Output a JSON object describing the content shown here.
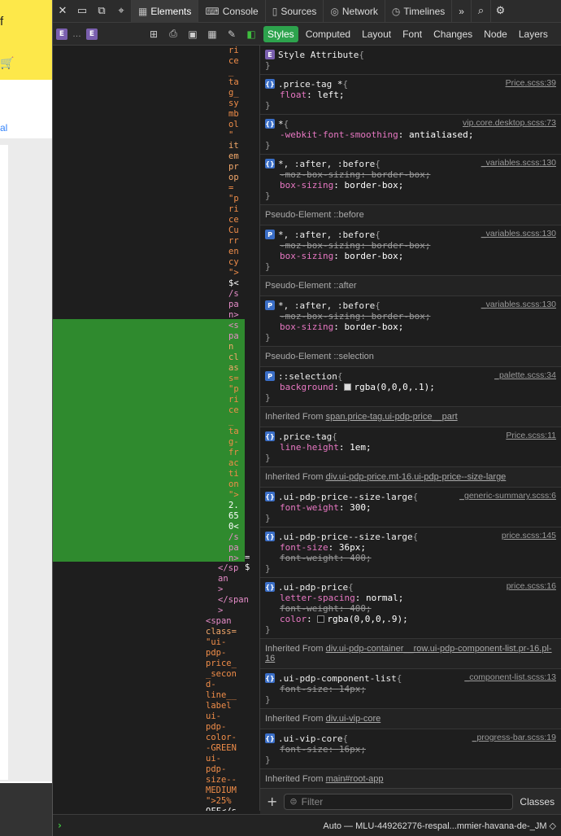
{
  "page": {
    "yellow_text": "f",
    "cart_icon": "cart-icon",
    "link_text": "al"
  },
  "toolbar": {
    "tabs": [
      {
        "label": "Elements",
        "icon": "elements-icon"
      },
      {
        "label": "Console",
        "icon": "console-icon"
      },
      {
        "label": "Sources",
        "icon": "sources-icon"
      },
      {
        "label": "Network",
        "icon": "network-icon"
      },
      {
        "label": "Timelines",
        "icon": "timelines-icon"
      }
    ],
    "more": "»"
  },
  "breadcrumb": {
    "badge1": "E",
    "ellipsis": "…",
    "badge2": "E"
  },
  "sidebar_tabs": [
    "Styles",
    "Computed",
    "Layout",
    "Font",
    "Changes",
    "Node",
    "Layers"
  ],
  "dom": {
    "col1": [
      "ri",
      "ce",
      "_",
      "ta",
      "g_",
      "sy",
      "mb",
      "ol",
      "\"",
      "it",
      "em",
      "pr",
      "op",
      "=",
      "\"p",
      "ri",
      "ce",
      "Cu",
      "rr",
      "en",
      "cy",
      "\">",
      "$<",
      "/s",
      "pa",
      "n>",
      "<s",
      "pa",
      "n",
      "cl",
      "as",
      "s=",
      "\"p",
      "ri",
      "ce",
      "_",
      "ta",
      "g-",
      "fr",
      "ac",
      "ti",
      "on",
      "\">",
      "2.",
      "65",
      "0<",
      "/s",
      "pa",
      "n>"
    ],
    "equals": "= $",
    "col2": [
      "</sp",
      "an",
      ">",
      "</span",
      ">"
    ],
    "col3": [
      "<span",
      "class=",
      "\"ui-",
      "pdp-",
      "price_",
      "_secon",
      "d-",
      "line__",
      "label",
      "ui-",
      "pdp-",
      "color-",
      "-GREEN",
      "ui-",
      "pdp-",
      "size--",
      "MEDIUM",
      "\">25%",
      "OFF</s"
    ]
  },
  "styles": {
    "rules": [
      {
        "badge": "E",
        "selector": "Style Attribute",
        "source": "",
        "decls": []
      },
      {
        "badge": "{}",
        "selector": ".price-tag *",
        "source": "Price.scss:39",
        "decls": [
          {
            "p": "float",
            "v": "left",
            "s": false
          }
        ]
      },
      {
        "badge": "{}",
        "selector": "*",
        "source": "vip.core.desktop.scss:73",
        "decls": [
          {
            "p": "-webkit-font-smoothing",
            "v": "antialiased",
            "s": false
          }
        ]
      },
      {
        "badge": "{}",
        "selector": "*, :after, :before",
        "source": "_variables.scss:130",
        "decls": [
          {
            "p": "-moz-box-sizing",
            "v": "border-box",
            "s": true
          },
          {
            "p": "box-sizing",
            "v": "border-box",
            "s": false
          }
        ]
      }
    ],
    "section_before": "Pseudo-Element ::before",
    "rule_before": {
      "badge": "P",
      "selector": "*, :after, :before",
      "source": "_variables.scss:130",
      "decls": [
        {
          "p": "-moz-box-sizing",
          "v": "border-box",
          "s": true
        },
        {
          "p": "box-sizing",
          "v": "border-box",
          "s": false
        }
      ]
    },
    "section_after": "Pseudo-Element ::after",
    "rule_after": {
      "badge": "P",
      "selector": "*, :after, :before",
      "source": "_variables.scss:130",
      "decls": [
        {
          "p": "-moz-box-sizing",
          "v": "border-box",
          "s": true
        },
        {
          "p": "box-sizing",
          "v": "border-box",
          "s": false
        }
      ]
    },
    "section_selection": "Pseudo-Element ::selection",
    "rule_selection": {
      "badge": "P",
      "selector": "::selection",
      "source": "_palette.scss:34",
      "decls": [
        {
          "p": "background",
          "v": "rgba(0,0,0,.1)",
          "s": false,
          "swatch": "light"
        }
      ]
    },
    "inh1_label": "Inherited From",
    "inh1_link": "span.price-tag.ui-pdp-price__part",
    "rule_inh1": {
      "badge": "{}",
      "selector": ".price-tag",
      "source": "Price.scss:11",
      "decls": [
        {
          "p": "line-height",
          "v": "1em",
          "s": false
        }
      ]
    },
    "inh2_label": "Inherited From",
    "inh2_link": "div.ui-pdp-price.mt-16.ui-pdp-price--size-large",
    "rules_inh2": [
      {
        "badge": "{}",
        "selector": ".ui-pdp-price--size-large",
        "source": "_generic-summary.scss:6",
        "decls": [
          {
            "p": "font-weight",
            "v": "300",
            "s": false
          }
        ]
      },
      {
        "badge": "{}",
        "selector": ".ui-pdp-price--size-large",
        "source": "price.scss:145",
        "decls": [
          {
            "p": "font-size",
            "v": "36px",
            "s": false
          },
          {
            "p": "font-weight",
            "v": "400",
            "s": true
          }
        ]
      },
      {
        "badge": "{}",
        "selector": ".ui-pdp-price",
        "source": "price.scss:16",
        "decls": [
          {
            "p": "letter-spacing",
            "v": "normal",
            "s": false
          },
          {
            "p": "font-weight",
            "v": "400",
            "s": true
          },
          {
            "p": "color",
            "v": "rgba(0,0,0,.9)",
            "s": false,
            "swatch": "dark"
          }
        ]
      }
    ],
    "inh3_label": "Inherited From",
    "inh3_link": "div.ui-pdp-container__row.ui-pdp-component-list.pr-16.pl-16",
    "rule_inh3": {
      "badge": "{}",
      "selector": ".ui-pdp-component-list",
      "source": "_component-list.scss:13",
      "decls": [
        {
          "p": "font-size",
          "v": "14px",
          "s": true
        }
      ]
    },
    "inh4_label": "Inherited From",
    "inh4_link": "div.ui-vip-core",
    "rule_inh4": {
      "badge": "{}",
      "selector": ".ui-vip-core",
      "source": "_progress-bar.scss:19",
      "decls": [
        {
          "p": "font-size",
          "v": "16px",
          "s": true
        }
      ]
    },
    "inh5_label": "Inherited From",
    "inh5_link": "main#root-app"
  },
  "filter": {
    "placeholder": "Filter",
    "classes": "Classes",
    "add": "+"
  },
  "console": {
    "prompt": "›",
    "context": "Auto — MLU-449262776-respal...mmier-havana-de-_JM ◇"
  }
}
